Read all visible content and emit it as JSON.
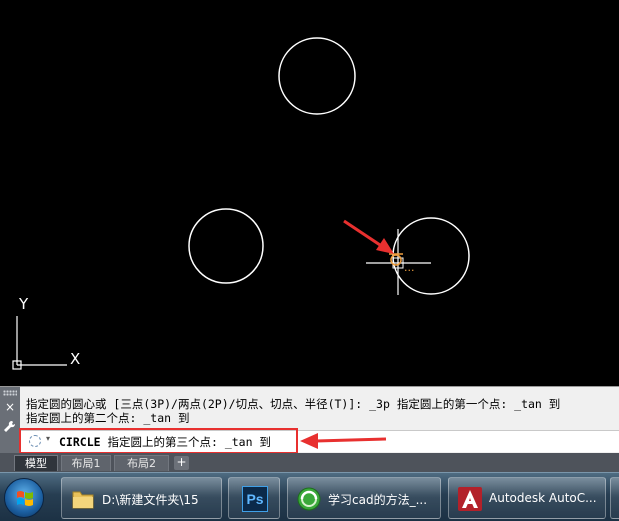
{
  "command_line": {
    "history_line1": "指定圆的圆心或 [三点(3P)/两点(2P)/切点、切点、半径(T)]: _3p 指定圆上的第一个点: _tan 到",
    "history_line2": "指定圆上的第二个点: _tan 到",
    "prompt_command": "CIRCLE",
    "prompt_text": " 指定圆上的第三个点: _tan 到",
    "close_glyph": "×",
    "settings_glyph": "🔧",
    "dropdown_glyph": "▾"
  },
  "canvas": {
    "ucs_x_label": "X",
    "ucs_y_label": "Y",
    "snap_ellipsis": "..."
  },
  "layout_tabs": {
    "tabs": [
      "模型",
      "布局1",
      "布局2"
    ],
    "active": "模型",
    "add_label": "+"
  },
  "taskbar": {
    "items": [
      {
        "label": "D:\\新建文件夹\\15",
        "icon": "folder-icon"
      },
      {
        "label": "",
        "icon": "photoshop-icon",
        "icon_text": "Ps"
      },
      {
        "label": "学习cad的方法_...",
        "icon": "browser-icon"
      },
      {
        "label": "Autodesk AutoC...",
        "icon": "autocad-icon"
      }
    ]
  },
  "colors": {
    "canvas_bg": "#000000",
    "geometry": "#ffffff",
    "highlight": "#e8302f",
    "snap_marker": "#f0a040"
  }
}
